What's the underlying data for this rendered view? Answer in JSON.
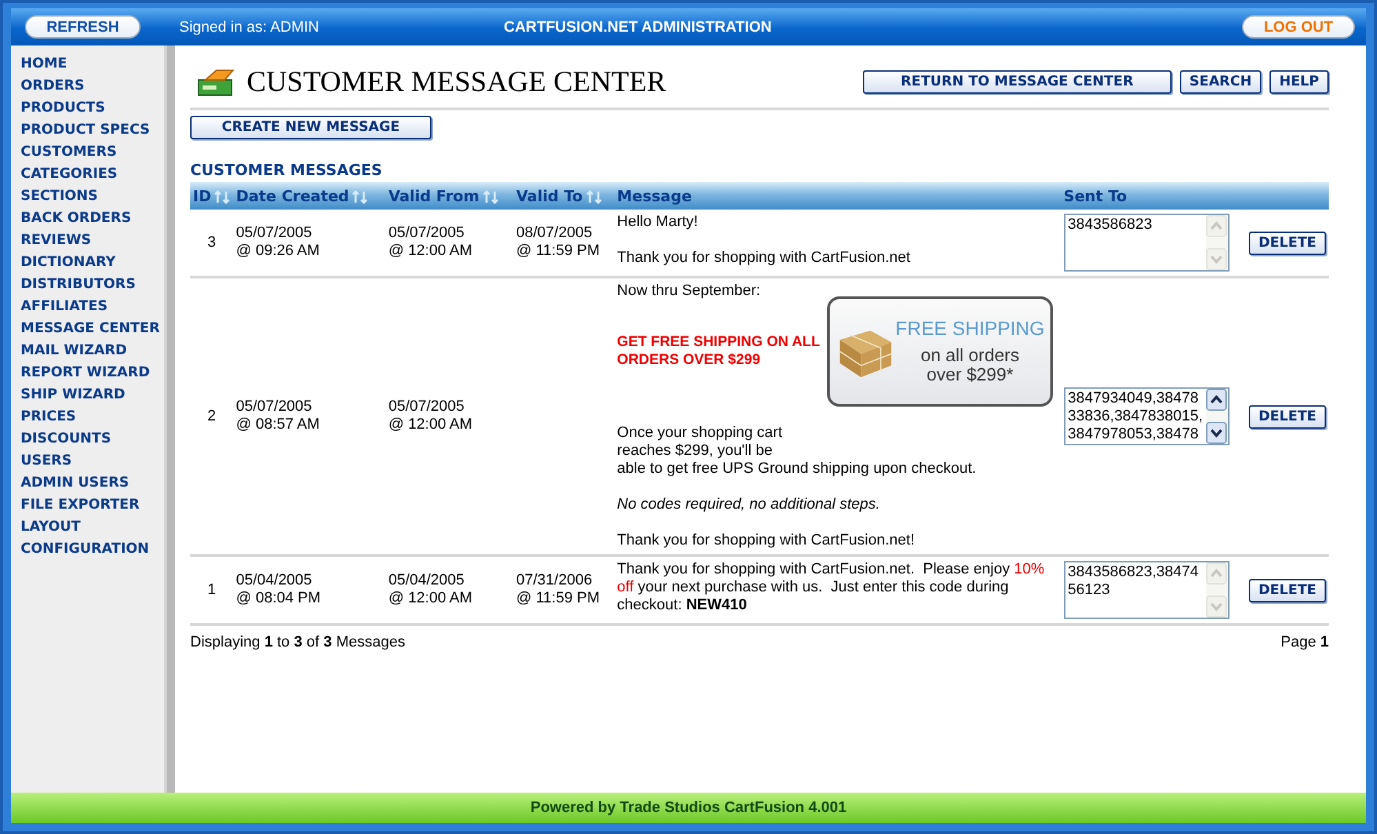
{
  "top_bar": {
    "refresh_button": "REFRESH",
    "signed_in": "Signed in as: ADMIN",
    "title": "CARTFUSION.NET ADMINISTRATION",
    "logout_button": "LOG OUT"
  },
  "sidebar": {
    "items": [
      {
        "label": "HOME"
      },
      {
        "label": "ORDERS"
      },
      {
        "label": "PRODUCTS"
      },
      {
        "label": "PRODUCT SPECS"
      },
      {
        "label": "CUSTOMERS"
      },
      {
        "label": "CATEGORIES"
      },
      {
        "label": "SECTIONS"
      },
      {
        "label": "BACK ORDERS"
      },
      {
        "label": "REVIEWS"
      },
      {
        "label": "DICTIONARY"
      },
      {
        "label": "DISTRIBUTORS"
      },
      {
        "label": "AFFILIATES"
      },
      {
        "label": "MESSAGE CENTER"
      },
      {
        "label": "MAIL WIZARD"
      },
      {
        "label": "REPORT WIZARD"
      },
      {
        "label": "SHIP WIZARD"
      },
      {
        "label": "PRICES"
      },
      {
        "label": "DISCOUNTS"
      },
      {
        "label": "USERS"
      },
      {
        "label": "ADMIN USERS"
      },
      {
        "label": "FILE EXPORTER"
      },
      {
        "label": "LAYOUT"
      },
      {
        "label": "CONFIGURATION"
      }
    ]
  },
  "page": {
    "title": "CUSTOMER MESSAGE CENTER",
    "buttons": [
      "RETURN TO MESSAGE CENTER",
      "SEARCH",
      "HELP"
    ],
    "create_button": "CREATE NEW MESSAGE",
    "section_title": "CUSTOMER MESSAGES"
  },
  "table": {
    "columns": [
      {
        "label": "ID",
        "sortable": true
      },
      {
        "label": "Date Created",
        "sortable": true
      },
      {
        "label": "Valid From",
        "sortable": true
      },
      {
        "label": "Valid To",
        "sortable": true
      },
      {
        "label": "Message",
        "sortable": false
      },
      {
        "label": "Sent To",
        "sortable": false
      }
    ],
    "rows": [
      {
        "id": "3",
        "date_created": [
          "05/07/2005",
          "@ 09:26 AM"
        ],
        "valid_from": [
          "05/07/2005",
          "@ 12:00 AM"
        ],
        "valid_to": [
          "08/07/2005",
          "@ 11:59 PM"
        ],
        "message": [
          {
            "kind": "text",
            "lines": [
              "Hello Marty!"
            ]
          },
          {
            "kind": "text",
            "lines": [
              "Thank you for shopping with CartFusion.net"
            ]
          }
        ],
        "sent_to": [
          "3843586823"
        ],
        "scroll_enabled": false,
        "delete_button": "DELETE"
      },
      {
        "id": "2",
        "date_created": [
          "05/07/2005",
          "@ 08:57 AM"
        ],
        "valid_from": [
          "05/07/2005",
          "@ 12:00 AM"
        ],
        "valid_to": [],
        "message": [
          {
            "kind": "text",
            "lines": [
              "Now thru September:"
            ]
          },
          {
            "kind": "alert",
            "lines": [
              "GET FREE SHIPPING ON ALL",
              "ORDERS OVER $299"
            ]
          },
          {
            "kind": "banner",
            "title": "FREE SHIPPING",
            "lines": [
              "on all orders",
              "over $299*"
            ]
          },
          {
            "kind": "text",
            "lines": [
              "Once your shopping cart",
              "reaches $299, you'll be",
              "able to get free UPS Ground shipping upon checkout."
            ]
          },
          {
            "kind": "note",
            "lines": [
              "No codes required, no additional steps."
            ]
          },
          {
            "kind": "text",
            "lines": [
              "Thank you for shopping with CartFusion.net!"
            ]
          }
        ],
        "sent_to": [
          "3847934049,38478",
          "33836,3847838015,",
          "3847978053,38478"
        ],
        "scroll_enabled": true,
        "delete_button": "DELETE"
      },
      {
        "id": "1",
        "date_created": [
          "05/04/2005",
          "@ 08:04 PM"
        ],
        "valid_from": [
          "05/04/2005",
          "@ 12:00 AM"
        ],
        "valid_to": [
          "07/31/2006",
          "@ 11:59 PM"
        ],
        "message": [
          {
            "kind": "mixed",
            "parts": [
              {
                "text": "Thank you for shopping with CartFusion.net.  Please enjoy ",
                "highlight": false
              },
              {
                "text": "10% off",
                "highlight": true
              },
              {
                "text": " your next purchase with us.  Just enter this code during checkout: **NEW410**",
                "highlight": false
              }
            ]
          }
        ],
        "sent_to": [
          "3843586823,38474",
          "56123"
        ],
        "scroll_enabled": false,
        "delete_button": "DELETE"
      }
    ]
  },
  "footer_left": "Displaying **1** to **3** of **3** Messages",
  "footer_right": "Page **1**",
  "status_bar": "Powered by Trade Studios CartFusion 4.001"
}
